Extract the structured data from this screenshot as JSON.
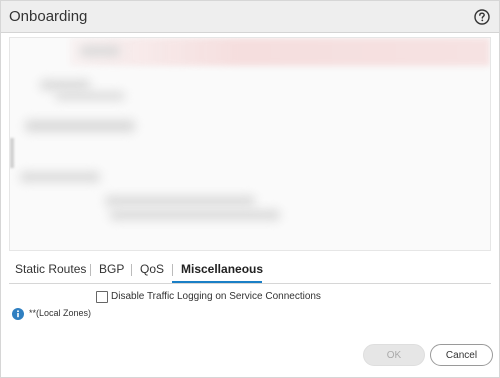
{
  "dialog": {
    "title": "Onboarding",
    "help_icon": "question-circle-icon"
  },
  "tabs": [
    {
      "label": "Static Routes",
      "active": false
    },
    {
      "label": "BGP",
      "active": false
    },
    {
      "label": "QoS",
      "active": false
    },
    {
      "label": "Miscellaneous",
      "active": true
    }
  ],
  "misc": {
    "disable_logging_label": "Disable Traffic Logging on Service Connections",
    "disable_logging_checked": false,
    "info_icon": "info-icon",
    "info_text": "**(Local Zones)"
  },
  "buttons": {
    "ok_label": "OK",
    "cancel_label": "Cancel"
  },
  "colors": {
    "accent": "#1a7fc6",
    "info": "#2f7fc1"
  }
}
